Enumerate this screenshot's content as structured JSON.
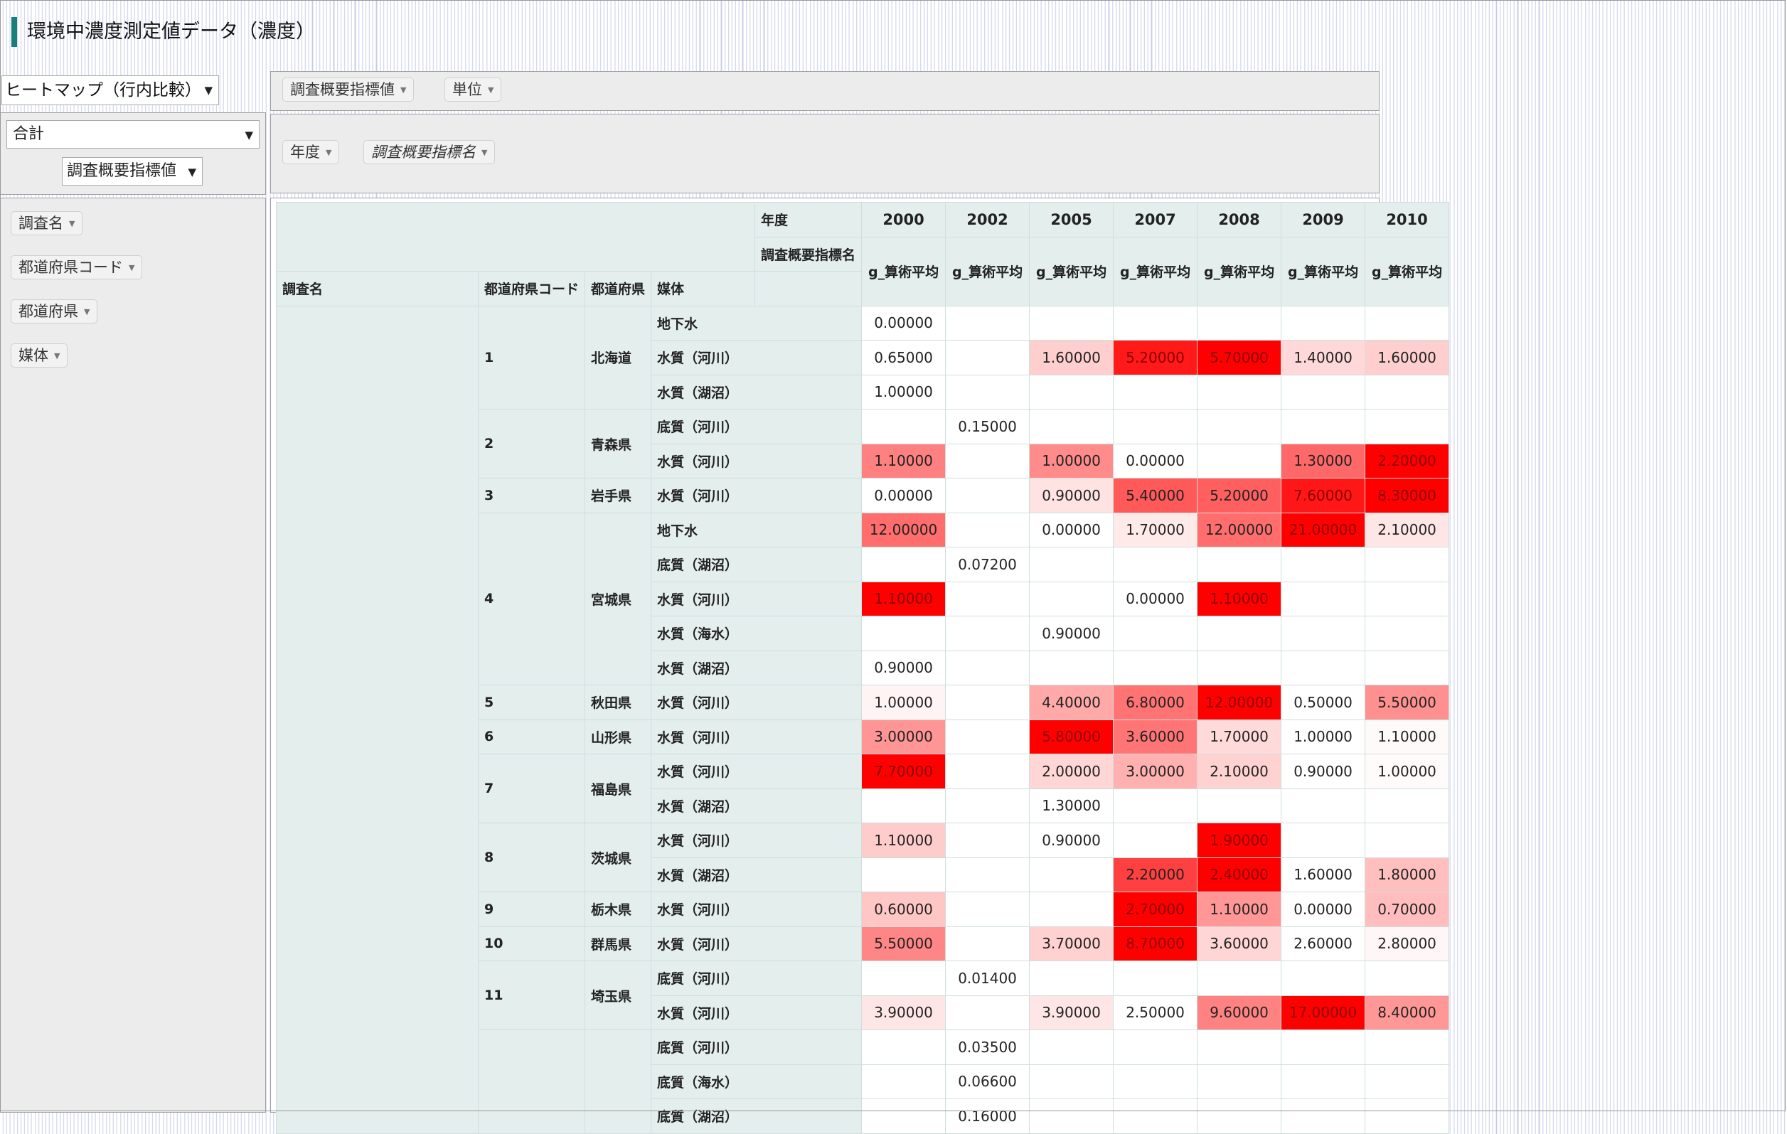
{
  "app": {
    "title": "環境中濃度測定値データ（濃度）",
    "accent_color": "#1b7f79"
  },
  "controls": {
    "renderer": "ヒートマップ（行内比較）",
    "aggregator": "合計",
    "value_field": "調査概要指標値",
    "dropdown_icon": "caret-down-icon"
  },
  "col_area": [
    {
      "label": "調査概要指標値",
      "italic": false
    },
    {
      "label": "単位",
      "italic": false
    }
  ],
  "row_area": [
    {
      "label": "年度",
      "italic": false
    },
    {
      "label": "調査概要指標名",
      "italic": true
    }
  ],
  "unused_attrs": [
    {
      "label": "調査名"
    },
    {
      "label": "都道府県コード"
    },
    {
      "label": "都道府県"
    },
    {
      "label": "媒体"
    }
  ],
  "pivot": {
    "col_attr_1": "年度",
    "col_attr_2": "調査概要指標名",
    "row_attrs": [
      "調査名",
      "都道府県コード",
      "都道府県",
      "媒体"
    ],
    "years": [
      "2000",
      "2002",
      "2005",
      "2007",
      "2008",
      "2009",
      "2010"
    ],
    "measure": "g_算術平均",
    "heat_color": "#ff0000",
    "groups": [
      {
        "code": "1",
        "pref": "北海道",
        "rows": [
          {
            "medium": "地下水",
            "values": [
              "0.00000",
              "",
              "",
              "",
              "",
              "",
              ""
            ]
          },
          {
            "medium": "水質（河川）",
            "values": [
              "0.65000",
              "",
              "1.60000",
              "5.20000",
              "5.70000",
              "1.40000",
              "1.60000"
            ]
          },
          {
            "medium": "水質（湖沼）",
            "values": [
              "1.00000",
              "",
              "",
              "",
              "",
              "",
              ""
            ]
          }
        ]
      },
      {
        "code": "2",
        "pref": "青森県",
        "rows": [
          {
            "medium": "底質（河川）",
            "values": [
              "",
              "0.15000",
              "",
              "",
              "",
              "",
              ""
            ]
          },
          {
            "medium": "水質（河川）",
            "values": [
              "1.10000",
              "",
              "1.00000",
              "0.00000",
              "",
              "1.30000",
              "2.20000"
            ]
          }
        ]
      },
      {
        "code": "3",
        "pref": "岩手県",
        "rows": [
          {
            "medium": "水質（河川）",
            "values": [
              "0.00000",
              "",
              "0.90000",
              "5.40000",
              "5.20000",
              "7.60000",
              "8.30000"
            ]
          }
        ]
      },
      {
        "code": "4",
        "pref": "宮城県",
        "rows": [
          {
            "medium": "地下水",
            "values": [
              "12.00000",
              "",
              "0.00000",
              "1.70000",
              "12.00000",
              "21.00000",
              "2.10000"
            ]
          },
          {
            "medium": "底質（湖沼）",
            "values": [
              "",
              "0.07200",
              "",
              "",
              "",
              "",
              ""
            ]
          },
          {
            "medium": "水質（河川）",
            "values": [
              "1.10000",
              "",
              "",
              "0.00000",
              "1.10000",
              "",
              ""
            ]
          },
          {
            "medium": "水質（海水）",
            "values": [
              "",
              "",
              "0.90000",
              "",
              "",
              "",
              ""
            ]
          },
          {
            "medium": "水質（湖沼）",
            "values": [
              "0.90000",
              "",
              "",
              "",
              "",
              "",
              ""
            ]
          }
        ]
      },
      {
        "code": "5",
        "pref": "秋田県",
        "rows": [
          {
            "medium": "水質（河川）",
            "values": [
              "1.00000",
              "",
              "4.40000",
              "6.80000",
              "12.00000",
              "0.50000",
              "5.50000"
            ]
          }
        ]
      },
      {
        "code": "6",
        "pref": "山形県",
        "rows": [
          {
            "medium": "水質（河川）",
            "values": [
              "3.00000",
              "",
              "5.80000",
              "3.60000",
              "1.70000",
              "1.00000",
              "1.10000"
            ]
          }
        ]
      },
      {
        "code": "7",
        "pref": "福島県",
        "rows": [
          {
            "medium": "水質（河川）",
            "values": [
              "7.70000",
              "",
              "2.00000",
              "3.00000",
              "2.10000",
              "0.90000",
              "1.00000"
            ]
          },
          {
            "medium": "水質（湖沼）",
            "values": [
              "",
              "",
              "1.30000",
              "",
              "",
              "",
              ""
            ]
          }
        ]
      },
      {
        "code": "8",
        "pref": "茨城県",
        "rows": [
          {
            "medium": "水質（河川）",
            "values": [
              "1.10000",
              "",
              "0.90000",
              "",
              "1.90000",
              "",
              ""
            ]
          },
          {
            "medium": "水質（湖沼）",
            "values": [
              "",
              "",
              "",
              "2.20000",
              "2.40000",
              "1.60000",
              "1.80000"
            ]
          }
        ]
      },
      {
        "code": "9",
        "pref": "栃木県",
        "rows": [
          {
            "medium": "水質（河川）",
            "values": [
              "0.60000",
              "",
              "",
              "2.70000",
              "1.10000",
              "0.00000",
              "0.70000"
            ]
          }
        ]
      },
      {
        "code": "10",
        "pref": "群馬県",
        "rows": [
          {
            "medium": "水質（河川）",
            "values": [
              "5.50000",
              "",
              "3.70000",
              "8.70000",
              "3.60000",
              "2.60000",
              "2.80000"
            ]
          }
        ]
      },
      {
        "code": "11",
        "pref": "埼玉県",
        "rows": [
          {
            "medium": "底質（河川）",
            "values": [
              "",
              "0.01400",
              "",
              "",
              "",
              "",
              ""
            ]
          },
          {
            "medium": "水質（河川）",
            "values": [
              "3.90000",
              "",
              "3.90000",
              "2.50000",
              "9.60000",
              "17.00000",
              "8.40000"
            ]
          }
        ]
      },
      {
        "code": "",
        "pref": "",
        "rows": [
          {
            "medium": "底質（河川）",
            "values": [
              "",
              "0.03500",
              "",
              "",
              "",
              "",
              ""
            ]
          },
          {
            "medium": "底質（海水）",
            "values": [
              "",
              "0.06600",
              "",
              "",
              "",
              "",
              ""
            ]
          },
          {
            "medium": "底質（湖沼）",
            "values": [
              "",
              "0.16000",
              "",
              "",
              "",
              "",
              ""
            ]
          }
        ]
      }
    ]
  }
}
